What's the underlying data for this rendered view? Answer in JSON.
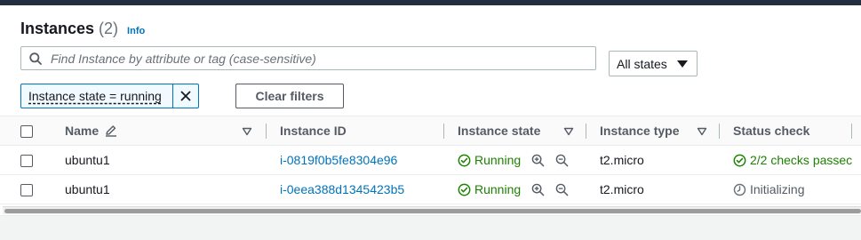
{
  "header": {
    "title": "Instances",
    "count": "(2)",
    "info_link": "Info"
  },
  "search": {
    "placeholder": "Find Instance by attribute or tag (case-sensitive)",
    "value": ""
  },
  "state_filter": {
    "selected": "All states"
  },
  "filter_token": {
    "label": "Instance state = running"
  },
  "clear_filters_label": "Clear filters",
  "table": {
    "columns": [
      "Name",
      "Instance ID",
      "Instance state",
      "Instance type",
      "Status check"
    ],
    "rows": [
      {
        "name": "ubuntu1",
        "instance_id": "i-0819f0b5fe8304e96",
        "state": "Running",
        "type": "t2.micro",
        "status_check": "2/2 checks passec",
        "status_kind": "ok"
      },
      {
        "name": "ubuntu1",
        "instance_id": "i-0eea388d1345423b5",
        "state": "Running",
        "type": "t2.micro",
        "status_check": "Initializing",
        "status_kind": "initializing"
      }
    ]
  },
  "colors": {
    "link": "#0073bb",
    "success": "#1d8102",
    "topbar": "#232f3e"
  }
}
